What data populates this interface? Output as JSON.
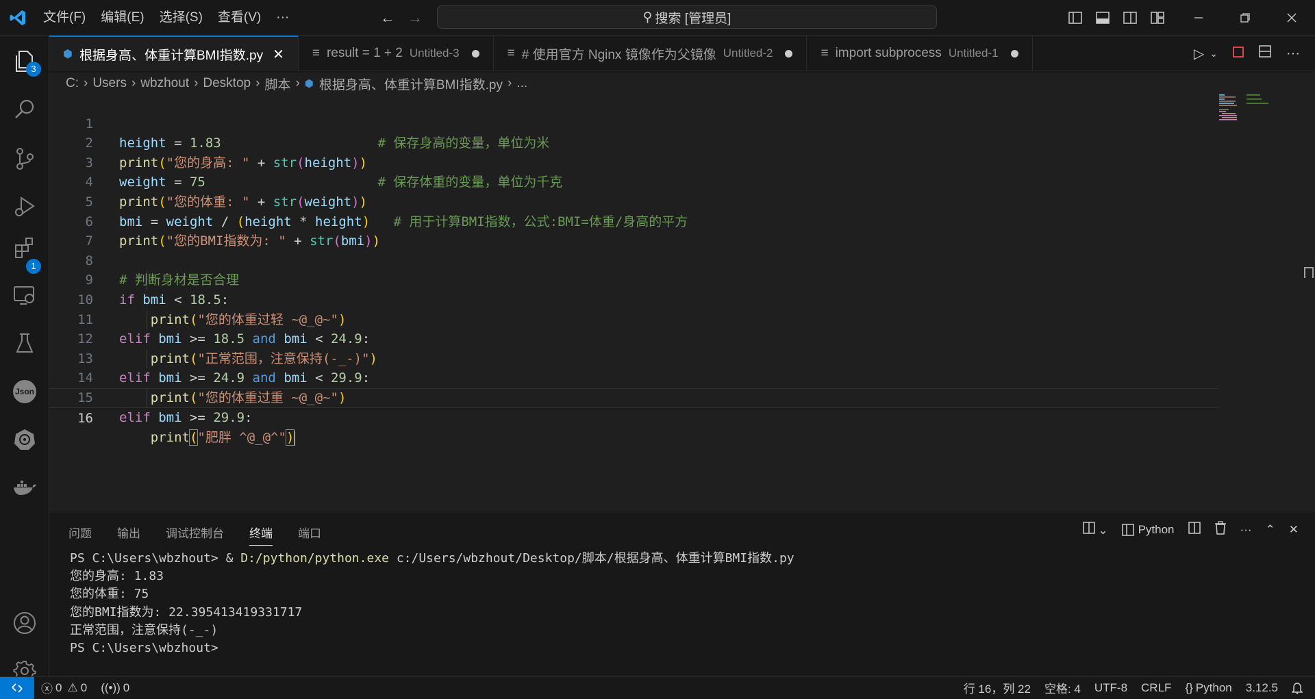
{
  "titlebar": {
    "menu": [
      "文件(F)",
      "编辑(E)",
      "选择(S)",
      "查看(V)",
      "···"
    ],
    "search": "搜索 [管理员]"
  },
  "activity": {
    "explorer_badge": "3",
    "extensions_badge": "1"
  },
  "tabs": [
    {
      "label": "根据身高、体重计算BMI指数.py",
      "sub": "",
      "active": true
    },
    {
      "label": "result = 1 + 2",
      "sub": "Untitled-3",
      "active": false
    },
    {
      "label": "# 使用官方 Nginx 镜像作为父镜像",
      "sub": "Untitled-2",
      "active": false
    },
    {
      "label": "import subprocess",
      "sub": "Untitled-1",
      "active": false
    }
  ],
  "breadcrumb": [
    "C:",
    "Users",
    "wbzhout",
    "Desktop",
    "脚本",
    "根据身高、体重计算BMI指数.py",
    "..."
  ],
  "editor": {
    "line_numbers": [
      "1",
      "2",
      "3",
      "4",
      "5",
      "6",
      "7",
      "8",
      "9",
      "10",
      "11",
      "12",
      "13",
      "14",
      "15",
      "16"
    ],
    "comments": {
      "c1": "# 保存身高的变量，单位为米",
      "c3": "# 保存体重的变量，单位为千克",
      "c5": "# 用于计算BMI指数，公式:BMI=体重/身高的平方",
      "c8": "# 判断身材是否合理"
    },
    "strings": {
      "s2": "\"您的身高: \"",
      "s4": "\"您的体重: \"",
      "s6": "\"您的BMI指数为: \"",
      "s10": "\"您的体重过轻 ~@_@~\"",
      "s12": "\"正常范围，注意保持(-_-)\"",
      "s14": "\"您的体重过重 ~@_@~\"",
      "s16": "\"肥胖 ^@_@^\""
    },
    "numbers": {
      "n1": "1.83",
      "n3": "75",
      "n9": "18.5",
      "n11a": "18.5",
      "n11b": "24.9",
      "n13a": "24.9",
      "n13b": "29.9",
      "n15": "29.9"
    }
  },
  "panel": {
    "tabs": [
      "问题",
      "输出",
      "调试控制台",
      "终端",
      "端口"
    ],
    "active_tab": "终端",
    "shell": "Python",
    "terminal": {
      "prompt": "PS C:\\Users\\wbzhout> & ",
      "exe": "D:/python/python.exe",
      "script": " c:/Users/wbzhout/Desktop/脚本/根据身高、体重计算BMI指数.py",
      "out1": "您的身高: 1.83",
      "out2": "您的体重: 75",
      "out3": "您的BMI指数为: 22.395413419331717",
      "out4": "正常范围，注意保持(-_-)",
      "prompt2": "PS C:\\Users\\wbzhout>"
    }
  },
  "status": {
    "errors": "0",
    "warnings": "0",
    "ports": "0",
    "position": "行 16，列 22",
    "spaces": "空格: 4",
    "encoding": "UTF-8",
    "eol": "CRLF",
    "language": "Python",
    "version": "3.12.5"
  },
  "colors": {
    "accent": "#0078d4",
    "background": "#1f1f1f"
  }
}
